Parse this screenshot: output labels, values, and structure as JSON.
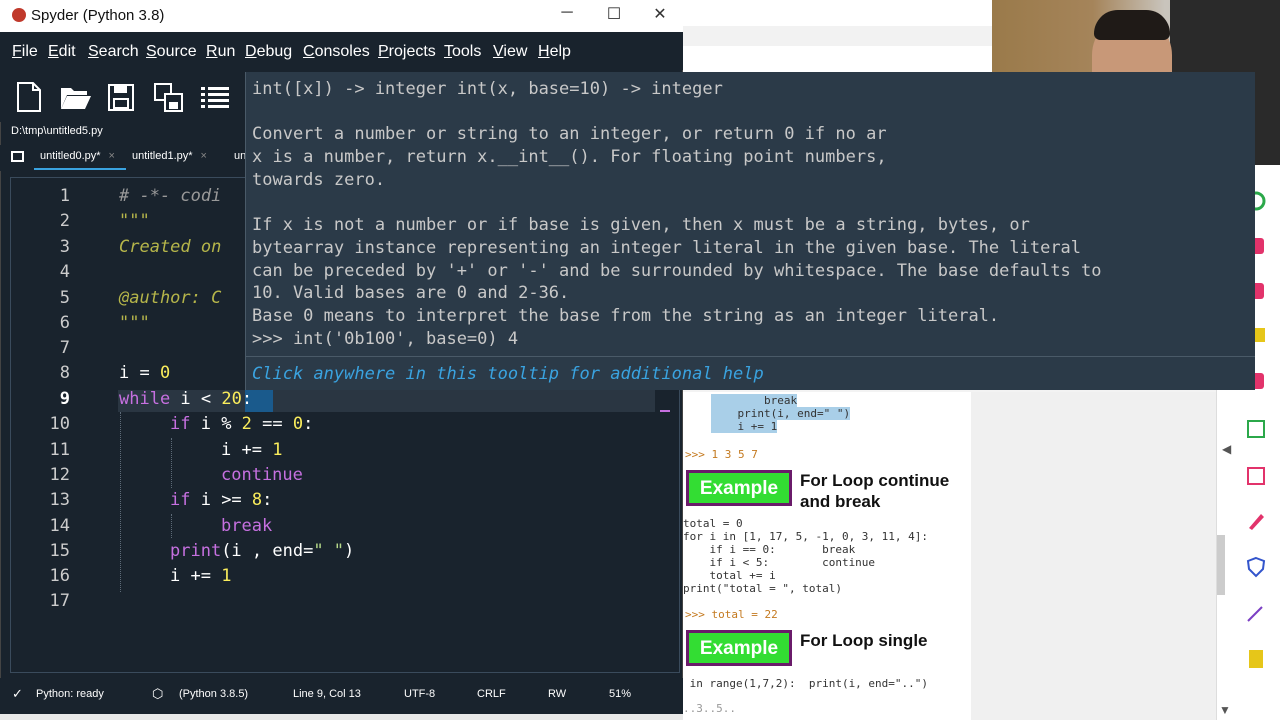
{
  "window": {
    "title": "Spyder (Python 3.8)",
    "controls": {
      "minimize": "─",
      "maximize": "☐",
      "close": "✕"
    }
  },
  "menu": [
    "File",
    "Edit",
    "Search",
    "Source",
    "Run",
    "Debug",
    "Consoles",
    "Projects",
    "Tools",
    "View",
    "Help"
  ],
  "menu_underlined": [
    "F",
    "E",
    "S",
    "S",
    "R",
    "D",
    "C",
    "P",
    "T",
    "V",
    "H"
  ],
  "menu_rest": [
    "ile",
    "dit",
    "earch",
    "ource",
    "un",
    "ebug",
    "onsoles",
    "rojects",
    "ools",
    "iew",
    "elp"
  ],
  "toolbar": {
    "icons": [
      "new-file-icon",
      "open-folder-icon",
      "save-icon",
      "save-all-icon",
      "outline-list-icon"
    ]
  },
  "editor": {
    "path": "D:\\tmp\\untitled5.py",
    "tabs": [
      {
        "label": "untitled0.py*",
        "close": "×"
      },
      {
        "label": "untitled1.py*",
        "close": "×"
      },
      {
        "label": "unt"
      }
    ],
    "line_numbers": [
      "1",
      "2",
      "3",
      "4",
      "5",
      "6",
      "7",
      "8",
      "9",
      "10",
      "11",
      "12",
      "13",
      "14",
      "15",
      "16",
      "17"
    ],
    "current_line": 9,
    "lines": {
      "l1": "# -*- codi",
      "l2": "\"\"\"",
      "l3": "Created on",
      "l5": "@author: C",
      "l6": "\"\"\"",
      "l8a": "i",
      "l8b": " = ",
      "l8c": "0",
      "l9a": "while",
      "l9b": " i < ",
      "l9c": "20",
      "l9d": ":",
      "l10a": "if",
      "l10b": " i % ",
      "l10c": "2",
      "l10d": " == ",
      "l10e": "0",
      "l10f": ":",
      "l11a": "i += ",
      "l11b": "1",
      "l12": "continue",
      "l13a": "if",
      "l13b": " i >= ",
      "l13c": "8",
      "l13d": ":",
      "l14": "break",
      "l15a": "print",
      "l15b": "(i , end=",
      "l15c": "\" \"",
      "l15d": ")",
      "l16a": "i += ",
      "l16b": "1"
    }
  },
  "tooltip": {
    "signature": "int([x]) -> integer int(x, base=10) -> integer",
    "p1": [
      "Convert a number or string to an integer, or return 0 if no ar",
      "x is a number, return x.__int__(). For floating point numbers,",
      "towards zero."
    ],
    "p2": [
      "If x is not a number or if base is given, then x must be a string, bytes, or",
      "bytearray instance representing an integer literal in the given base. The literal",
      "can be preceded by '+' or '-' and be surrounded by whitespace. The base defaults to",
      "10. Valid bases are 0 and 2-36.",
      "Base 0 means to interpret the base from the string as an integer literal.",
      ">>> int('0b100', base=0) 4"
    ],
    "hint": "Click anywhere in this tooltip for additional help"
  },
  "statusbar": {
    "kernel": "Python: ready",
    "env": "(Python 3.8.5)",
    "position": "Line 9, Col 13",
    "encoding": "UTF-8",
    "eol": "CRLF",
    "permissions": "RW",
    "memory": "51%"
  },
  "background_page": {
    "snippet_top": [
      "        break",
      "    print(i, end=\" \")",
      "    i += 1"
    ],
    "output1": ">>> 1 3 5 7",
    "example1": {
      "button": "Example",
      "title": "For Loop continue and break"
    },
    "code2": [
      "total = 0",
      "for i in [1, 17, 5, -1, 0, 3, 11, 4]:",
      "    if i == 0:       break",
      "    if i < 5:        continue",
      "    total += i",
      "print(\"total = \", total)"
    ],
    "output2": ">>> total =  22",
    "example2": {
      "button": "Example",
      "title": "For Loop single"
    },
    "code3": " in range(1,7,2):  print(i, end=\"..\")",
    "output3": "..3..5.."
  },
  "colors": {
    "editor_bg": "#19232d",
    "tooltip_bg": "#2b3a48",
    "keyword": "#c670e0",
    "number": "#faed5c",
    "string": "#b5d98a",
    "example_green": "#33dd33"
  }
}
